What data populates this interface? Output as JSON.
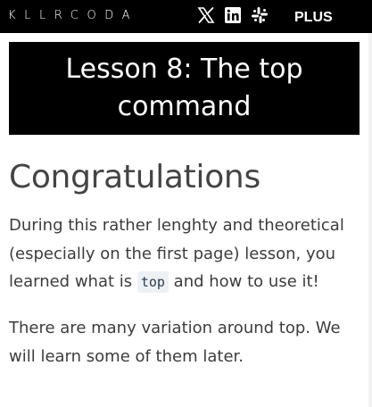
{
  "header": {
    "logo_text": "KLLRCODA",
    "social": [
      {
        "icon": "x-twitter-icon"
      },
      {
        "icon": "linkedin-icon"
      },
      {
        "icon": "slack-icon"
      }
    ],
    "plus_label": "PLUS"
  },
  "lesson": {
    "title": "Lesson 8: The top command"
  },
  "content": {
    "heading": "Congratulations",
    "paragraph1": {
      "before": "During this rather lenghty and theoretical (especially on the first page) lesson, you learned what is ",
      "code": "top",
      "after": " and how to use it!"
    },
    "paragraph2": "There are many variation around top. We will learn some of them later."
  },
  "colors": {
    "header_bg": "#000000",
    "title_bg": "#000000",
    "text": "#3c3c3c",
    "code_bg": "#eef1f4"
  }
}
